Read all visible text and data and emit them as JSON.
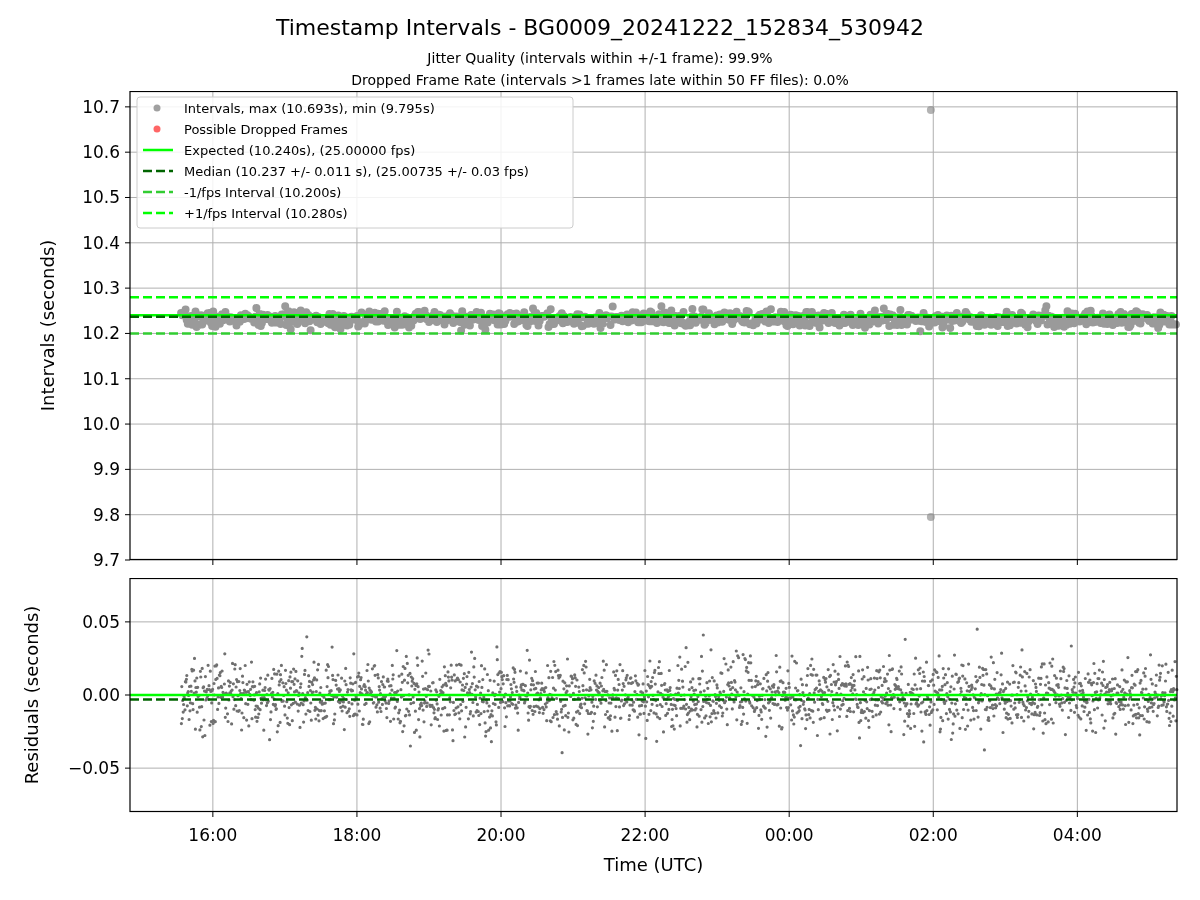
{
  "title": "Timestamp Intervals - BG0009_20241222_152834_530942",
  "subtitles": [
    "Jitter Quality (intervals within +/-1 frame): 99.9%",
    "Dropped Frame Rate (intervals >1 frames late within 50 FF files): 0.0%"
  ],
  "intervals_plot": {
    "legend": [
      {
        "kind": "marker",
        "label": "Intervals, max (10.693s), min (9.795s)",
        "color": "#a0a0a0"
      },
      {
        "kind": "marker",
        "label": "Possible Dropped Frames",
        "color": "#ff6666"
      },
      {
        "kind": "solid_line",
        "label": "Expected (10.240s), (25.00000 fps)",
        "color": "#00ff00"
      },
      {
        "kind": "dashed_line",
        "label": "Median (10.237 +/- 0.011 s), (25.00735 +/- 0.03 fps)",
        "color": "#006400"
      },
      {
        "kind": "dashed_line",
        "label": "-1/fps Interval (10.200s)",
        "color": "#32cd32"
      },
      {
        "kind": "dashed_line",
        "label": "+1/fps Interval (10.280s)",
        "color": "#00ff00"
      }
    ],
    "chart_data": {
      "type": "scatter",
      "ylabel": "Intervals (seconds)",
      "grid": true,
      "xlim": [
        "2024-12-22T14:51",
        "2024-12-23T05:23"
      ],
      "ylim": [
        9.7,
        10.735
      ],
      "yticks": [
        {
          "value": 9.7,
          "label": "9.7"
        },
        {
          "value": 9.8,
          "label": "9.8"
        },
        {
          "value": 9.9,
          "label": "9.9"
        },
        {
          "value": 10.0,
          "label": "10.0"
        },
        {
          "value": 10.1,
          "label": "10.1"
        },
        {
          "value": 10.2,
          "label": "10.2"
        },
        {
          "value": 10.3,
          "label": "10.3"
        },
        {
          "value": 10.4,
          "label": "10.4"
        },
        {
          "value": 10.5,
          "label": "10.5"
        },
        {
          "value": 10.6,
          "label": "10.6"
        },
        {
          "value": 10.7,
          "label": "10.7"
        }
      ],
      "series": [
        {
          "color": "#808080",
          "x": [
            "2024-12-23T01:58",
            "2024-12-23T01:58"
          ],
          "values": [
            10.693,
            9.795
          ]
        }
      ],
      "ref_lines": [
        {
          "axis": "y",
          "value": 10.24,
          "color": "#00ff00"
        },
        {
          "axis": "y",
          "value": 10.237,
          "color": "#006400"
        },
        {
          "axis": "y",
          "value": 10.2,
          "color": "#32cd32"
        },
        {
          "axis": "y",
          "value": 10.28,
          "color": "#00ff00"
        }
      ]
    }
  },
  "residuals_plot": {
    "chart_data": {
      "type": "scatter",
      "xlabel": "Time (UTC)",
      "ylabel": "Residuals (seconds)",
      "grid": true,
      "xlim": [
        "2024-12-22T14:51",
        "2024-12-23T05:23"
      ],
      "ylim": [
        -0.08,
        0.08
      ],
      "xticks": [
        {
          "value": "2024-12-22T16:00",
          "label": "16:00"
        },
        {
          "value": "2024-12-22T18:00",
          "label": "18:00"
        },
        {
          "value": "2024-12-22T20:00",
          "label": "20:00"
        },
        {
          "value": "2024-12-22T22:00",
          "label": "22:00"
        },
        {
          "value": "2024-12-23T00:00",
          "label": "00:00"
        },
        {
          "value": "2024-12-23T02:00",
          "label": "02:00"
        },
        {
          "value": "2024-12-23T04:00",
          "label": "04:00"
        }
      ],
      "yticks": [
        {
          "value": -0.05,
          "label": "−0.05"
        },
        {
          "value": 0,
          "label": "0.00"
        },
        {
          "value": 0.05,
          "label": "0.05"
        }
      ],
      "ref_lines": [
        {
          "axis": "y",
          "value": 0,
          "color": "#00ff00"
        },
        {
          "axis": "y",
          "value": -0.003,
          "color": "#006400"
        }
      ]
    }
  }
}
